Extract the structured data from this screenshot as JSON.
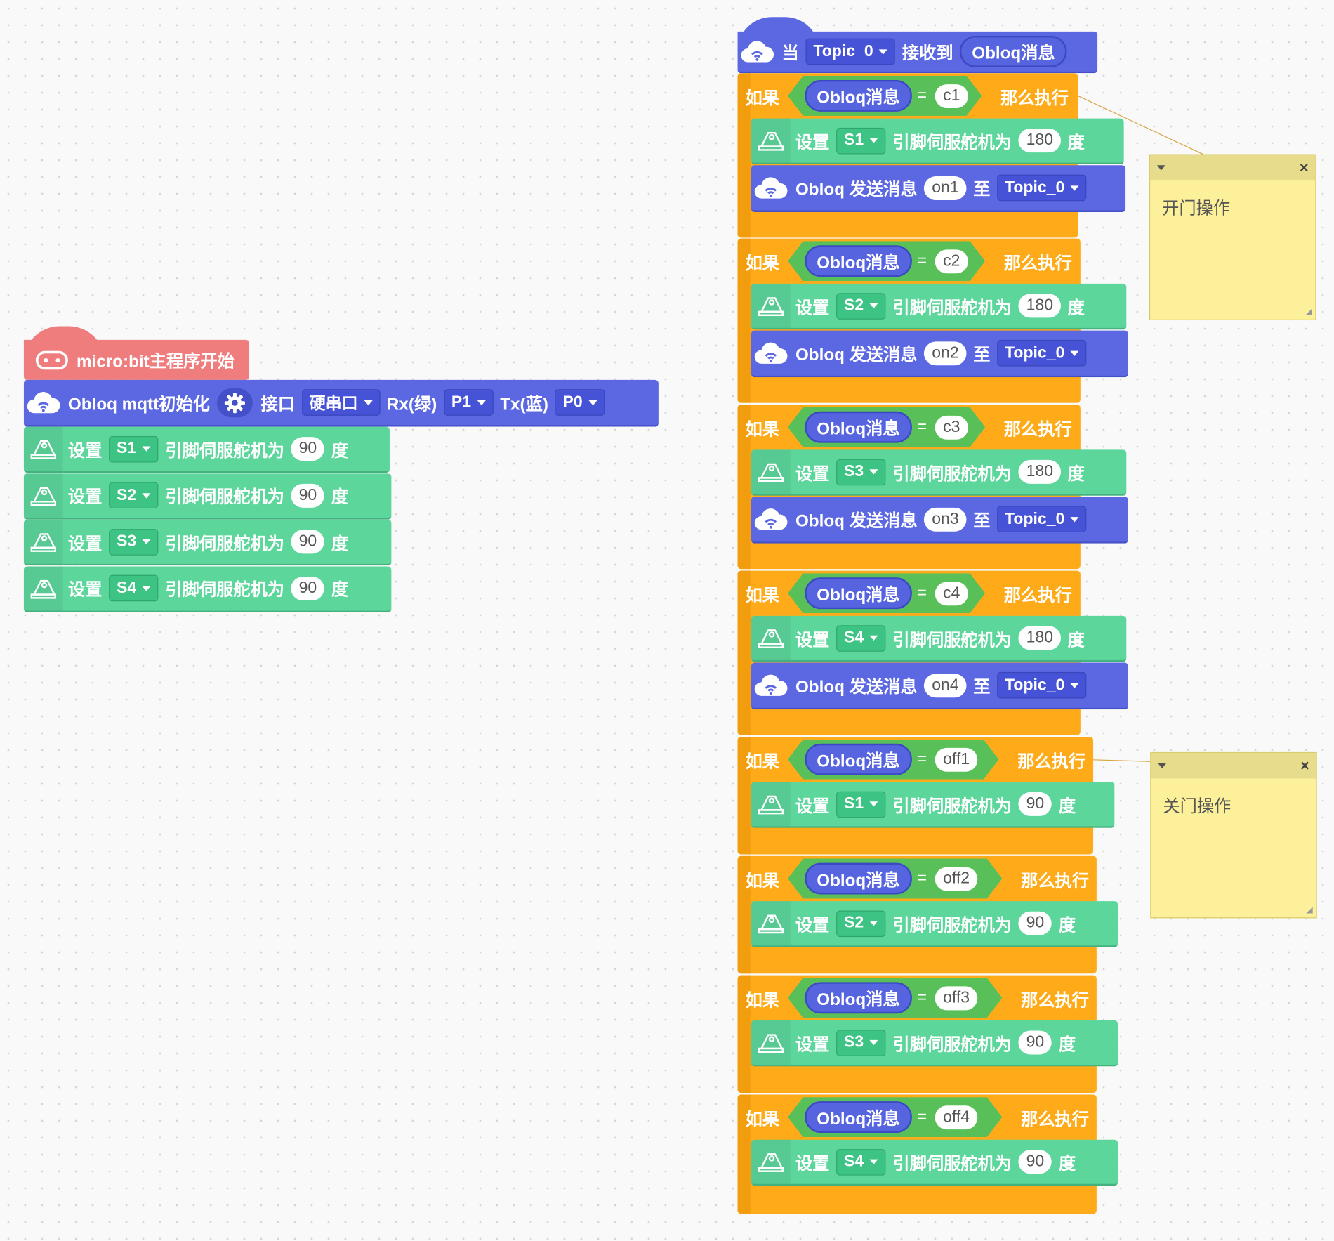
{
  "colors": {
    "control_orange": "#ffab19",
    "servo_green": "#5dd69c",
    "obloq_blue": "#5c68e2",
    "hat_red": "#f07d7d",
    "condition_green": "#59c059",
    "note_yellow": "#fdf09a"
  },
  "main_program": {
    "hat": {
      "label": "micro:bit主程序开始",
      "icon": "microbit-icon"
    },
    "init": {
      "label": "Obloq mqtt初始化",
      "icon": "cloud-wifi-icon",
      "settings_icon": "gear-icon",
      "port_label": "接口",
      "port_value": "硬串口",
      "rx_label": "Rx(绿)",
      "rx_value": "P1",
      "tx_label": "Tx(蓝)",
      "tx_value": "P0"
    },
    "servos": [
      {
        "set": "设置",
        "pin": "S1",
        "text": "引脚伺服舵机为",
        "angle": "90",
        "unit": "度"
      },
      {
        "set": "设置",
        "pin": "S2",
        "text": "引脚伺服舵机为",
        "angle": "90",
        "unit": "度"
      },
      {
        "set": "设置",
        "pin": "S3",
        "text": "引脚伺服舵机为",
        "angle": "90",
        "unit": "度"
      },
      {
        "set": "设置",
        "pin": "S4",
        "text": "引脚伺服舵机为",
        "angle": "90",
        "unit": "度"
      }
    ]
  },
  "event": {
    "hat": {
      "prefix": "当",
      "topic": "Topic_0",
      "middle": "接收到",
      "var": "Obloq消息",
      "icon": "cloud-wifi-icon"
    },
    "if_blocks": [
      {
        "if": "如果",
        "var": "Obloq消息",
        "eq": "=",
        "value": "c1",
        "then": "那么执行",
        "servo": {
          "set": "设置",
          "pin": "S1",
          "text": "引脚伺服舵机为",
          "angle": "180",
          "unit": "度"
        },
        "send": {
          "label": "Obloq 发送消息",
          "msg": "on1",
          "to": "至",
          "topic": "Topic_0"
        }
      },
      {
        "if": "如果",
        "var": "Obloq消息",
        "eq": "=",
        "value": "c2",
        "then": "那么执行",
        "servo": {
          "set": "设置",
          "pin": "S2",
          "text": "引脚伺服舵机为",
          "angle": "180",
          "unit": "度"
        },
        "send": {
          "label": "Obloq 发送消息",
          "msg": "on2",
          "to": "至",
          "topic": "Topic_0"
        }
      },
      {
        "if": "如果",
        "var": "Obloq消息",
        "eq": "=",
        "value": "c3",
        "then": "那么执行",
        "servo": {
          "set": "设置",
          "pin": "S3",
          "text": "引脚伺服舵机为",
          "angle": "180",
          "unit": "度"
        },
        "send": {
          "label": "Obloq 发送消息",
          "msg": "on3",
          "to": "至",
          "topic": "Topic_0"
        }
      },
      {
        "if": "如果",
        "var": "Obloq消息",
        "eq": "=",
        "value": "c4",
        "then": "那么执行",
        "servo": {
          "set": "设置",
          "pin": "S4",
          "text": "引脚伺服舵机为",
          "angle": "180",
          "unit": "度"
        },
        "send": {
          "label": "Obloq 发送消息",
          "msg": "on4",
          "to": "至",
          "topic": "Topic_0"
        }
      },
      {
        "if": "如果",
        "var": "Obloq消息",
        "eq": "=",
        "value": "off1",
        "then": "那么执行",
        "servo": {
          "set": "设置",
          "pin": "S1",
          "text": "引脚伺服舵机为",
          "angle": "90",
          "unit": "度"
        }
      },
      {
        "if": "如果",
        "var": "Obloq消息",
        "eq": "=",
        "value": "off2",
        "then": "那么执行",
        "servo": {
          "set": "设置",
          "pin": "S2",
          "text": "引脚伺服舵机为",
          "angle": "90",
          "unit": "度"
        }
      },
      {
        "if": "如果",
        "var": "Obloq消息",
        "eq": "=",
        "value": "off3",
        "then": "那么执行",
        "servo": {
          "set": "设置",
          "pin": "S3",
          "text": "引脚伺服舵机为",
          "angle": "90",
          "unit": "度"
        }
      },
      {
        "if": "如果",
        "var": "Obloq消息",
        "eq": "=",
        "value": "off4",
        "then": "那么执行",
        "servo": {
          "set": "设置",
          "pin": "S4",
          "text": "引脚伺服舵机为",
          "angle": "90",
          "unit": "度"
        }
      }
    ]
  },
  "notes": [
    {
      "text": "开门操作",
      "collapse_icon": "triangle-down-icon",
      "close_icon": "close-icon"
    },
    {
      "text": "关门操作",
      "collapse_icon": "triangle-down-icon",
      "close_icon": "close-icon"
    }
  ]
}
